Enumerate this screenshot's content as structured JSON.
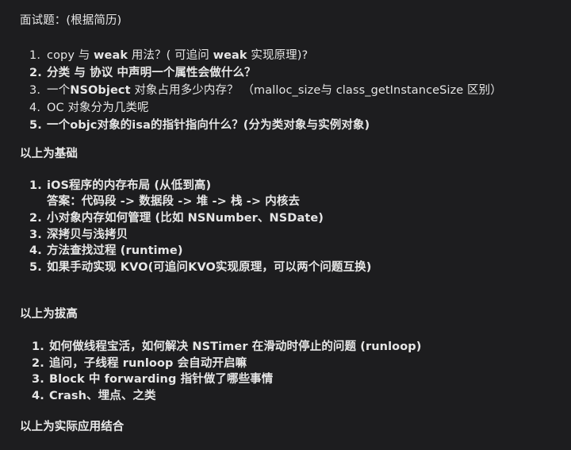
{
  "intro": "面试题：(根据简历)",
  "section1": {
    "items": [
      {
        "num": "1.",
        "parts": [
          "copy 与 ",
          "weak",
          " 用法？( 可追问 ",
          "weak",
          " 实现原理)?"
        ]
      },
      {
        "num": "2.",
        "text": "分类 与 协议 中声明一个属性会做什么？"
      },
      {
        "num": "3.",
        "parts": [
          "一个",
          "NSObject",
          " 对象占用多少内存？ （malloc_size与 class_getInstanceSize 区别）"
        ]
      },
      {
        "num": "4.",
        "text": "OC 对象分为几类呢"
      },
      {
        "num": "5.",
        "text": "一个objc对象的isa的指针指向什么？(分为类对象与实例对象)"
      }
    ],
    "footer": "以上为基础"
  },
  "section2": {
    "items": [
      {
        "num": "1.",
        "text": "iOS程序的内存布局 (从低到高)"
      },
      {
        "num": "",
        "text": "答案：代码段 -> 数据段 -> 堆 -> 栈 -> 内核去"
      },
      {
        "num": "2.",
        "text": "小对象内存如何管理 (比如 NSNumber、NSDate)"
      },
      {
        "num": "3.",
        "text": "深拷贝与浅拷贝"
      },
      {
        "num": "4.",
        "text": "方法查找过程 (runtime)"
      },
      {
        "num": "5.",
        "text": "如果手动实现 KVO(可追问KVO实现原理，可以两个问题互换)"
      }
    ],
    "footer": "以上为拔高"
  },
  "section3": {
    "items": [
      {
        "num": "1.",
        "text": "如何做线程宝活，如何解决 NSTimer 在滑动时停止的问题 (runloop)"
      },
      {
        "num": "2.",
        "text": "追问，子线程 runloop 会自动开启嘛"
      },
      {
        "num": "3.",
        "text": "Block 中 forwarding 指针做了哪些事情"
      },
      {
        "num": "4.",
        "text": "Crash、埋点、之类"
      }
    ],
    "footer": "以上为实际应用结合"
  }
}
